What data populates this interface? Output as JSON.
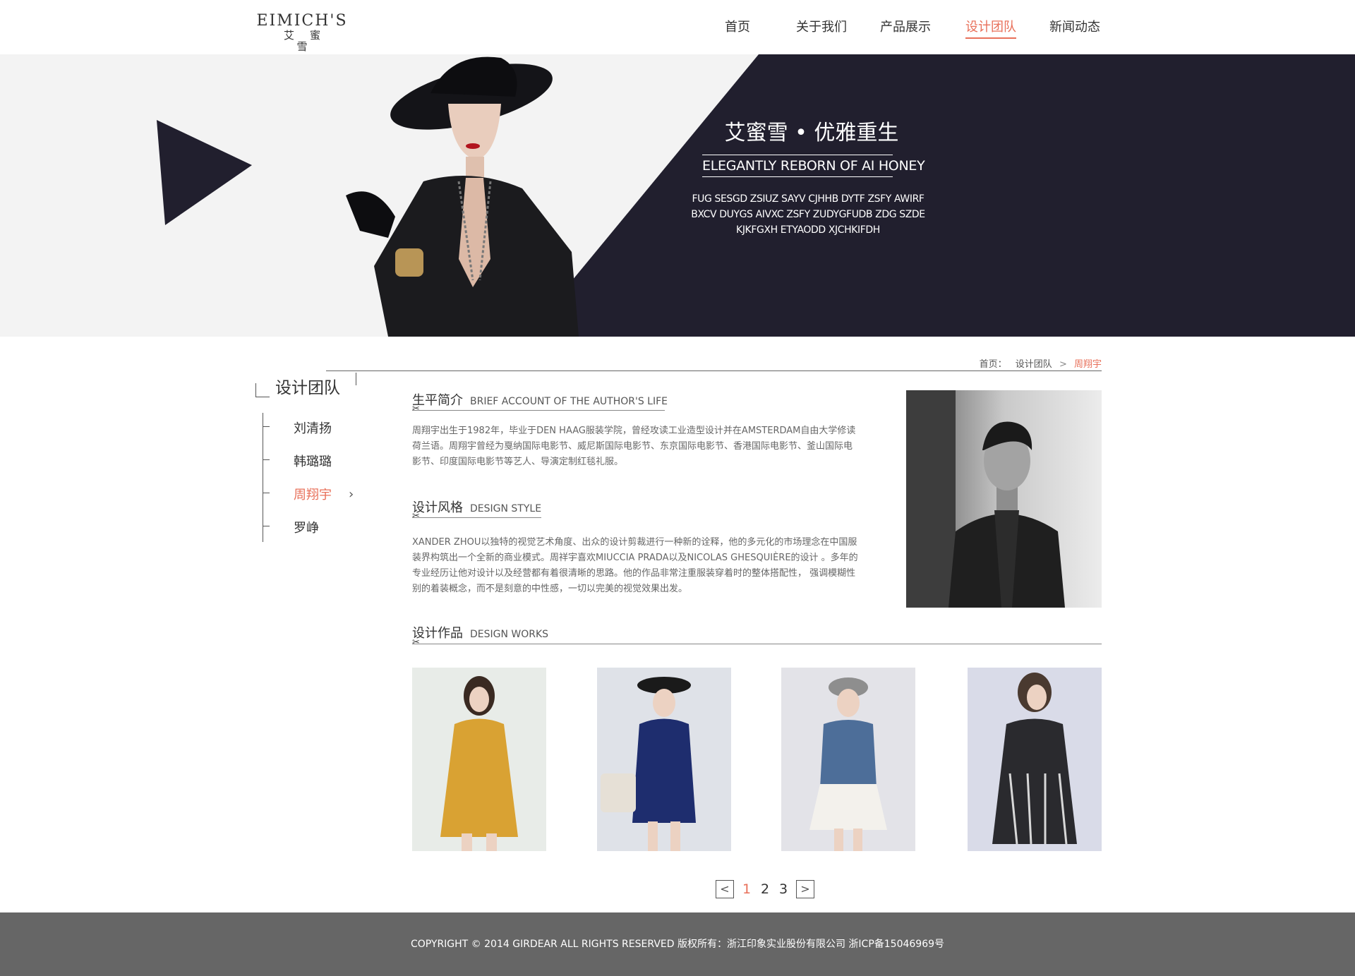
{
  "logo": {
    "en": "EIMICH'S",
    "cn": "艾蜜雪"
  },
  "nav": {
    "items": [
      {
        "label": "首页"
      },
      {
        "label": "关于我们"
      },
      {
        "label": "产品展示"
      },
      {
        "label": "设计团队"
      },
      {
        "label": "新闻动态"
      }
    ],
    "active_index": 3
  },
  "banner": {
    "title": "艾蜜雪 • 优雅重生",
    "subtitle": "ELEGANTLY REBORN OF AI HONEY",
    "desc_lines": [
      "FUG SESGD ZSIUZ SAYV CJHHB DYTF ZSFY AWIRF",
      "BXCV DUYGS AIVXC ZSFY ZUDYGFUDB ZDG SZDE",
      "KJKFGXH ETYAODD XJCHKIFDH"
    ]
  },
  "breadcrumb": {
    "home": "首页：",
    "section": "设计团队",
    "sep": ">",
    "current": "周翔宇"
  },
  "sidebar": {
    "title": "设计团队",
    "items": [
      {
        "label": "刘清扬"
      },
      {
        "label": "韩璐璐"
      },
      {
        "label": "周翔宇"
      },
      {
        "label": "罗峥"
      }
    ],
    "active_index": 2
  },
  "sections": {
    "bio": {
      "cn": "生平简介",
      "en": "BRIEF ACCOUNT OF THE AUTHOR'S LIFE",
      "lines": [
        "周翔宇出生于1982年，毕业于DEN HAAG服装学院，曾经攻读工业造型设计并在AMSTERDAM自由大学修读",
        "荷兰语。周翔宇曾经为戛纳国际电影节、威尼斯国际电影节、东京国际电影节、香港国际电影节、釜山国际电",
        "影节、印度国际电影节等艺人、导演定制红毯礼服。"
      ]
    },
    "style": {
      "cn": "设计风格",
      "en": "DESIGN STYLE",
      "lines": [
        "XANDER ZHOU以独特的视觉艺术角度、出众的设计剪裁进行一种新的诠释，他的多元化的市场理念在中国服",
        "装界构筑出一个全新的商业模式。周祥宇喜欢MIUCCIA PRADA以及NICOLAS GHESQUIÈRE的设计 。多年的",
        "专业经历让他对设计以及经营都有着很清晰的思路。他的作品非常注重服装穿着时的整体搭配性， 强调模糊性",
        "别的着装概念，而不是刻意的中性感，一切以完美的视觉效果出发。"
      ]
    },
    "works": {
      "cn": "设计作品",
      "en": "DESIGN WORKS"
    }
  },
  "pager": {
    "prev": "<",
    "pages": [
      "1",
      "2",
      "3"
    ],
    "active_index": 0,
    "next": ">"
  },
  "footer": {
    "text": "COPYRIGHT © 2014 GIRDEAR ALL RIGHTS RESERVED 版权所有：浙江印象实业股份有限公司  浙ICP备15046969号"
  },
  "colors": {
    "accent": "#e8705a",
    "banner_dark": "#211f2e",
    "footer_bg": "#666666"
  },
  "icons": {
    "scissors": "scissors-icon",
    "chevron_right": "chevron-right-icon",
    "play_triangle": "play-triangle-icon"
  }
}
